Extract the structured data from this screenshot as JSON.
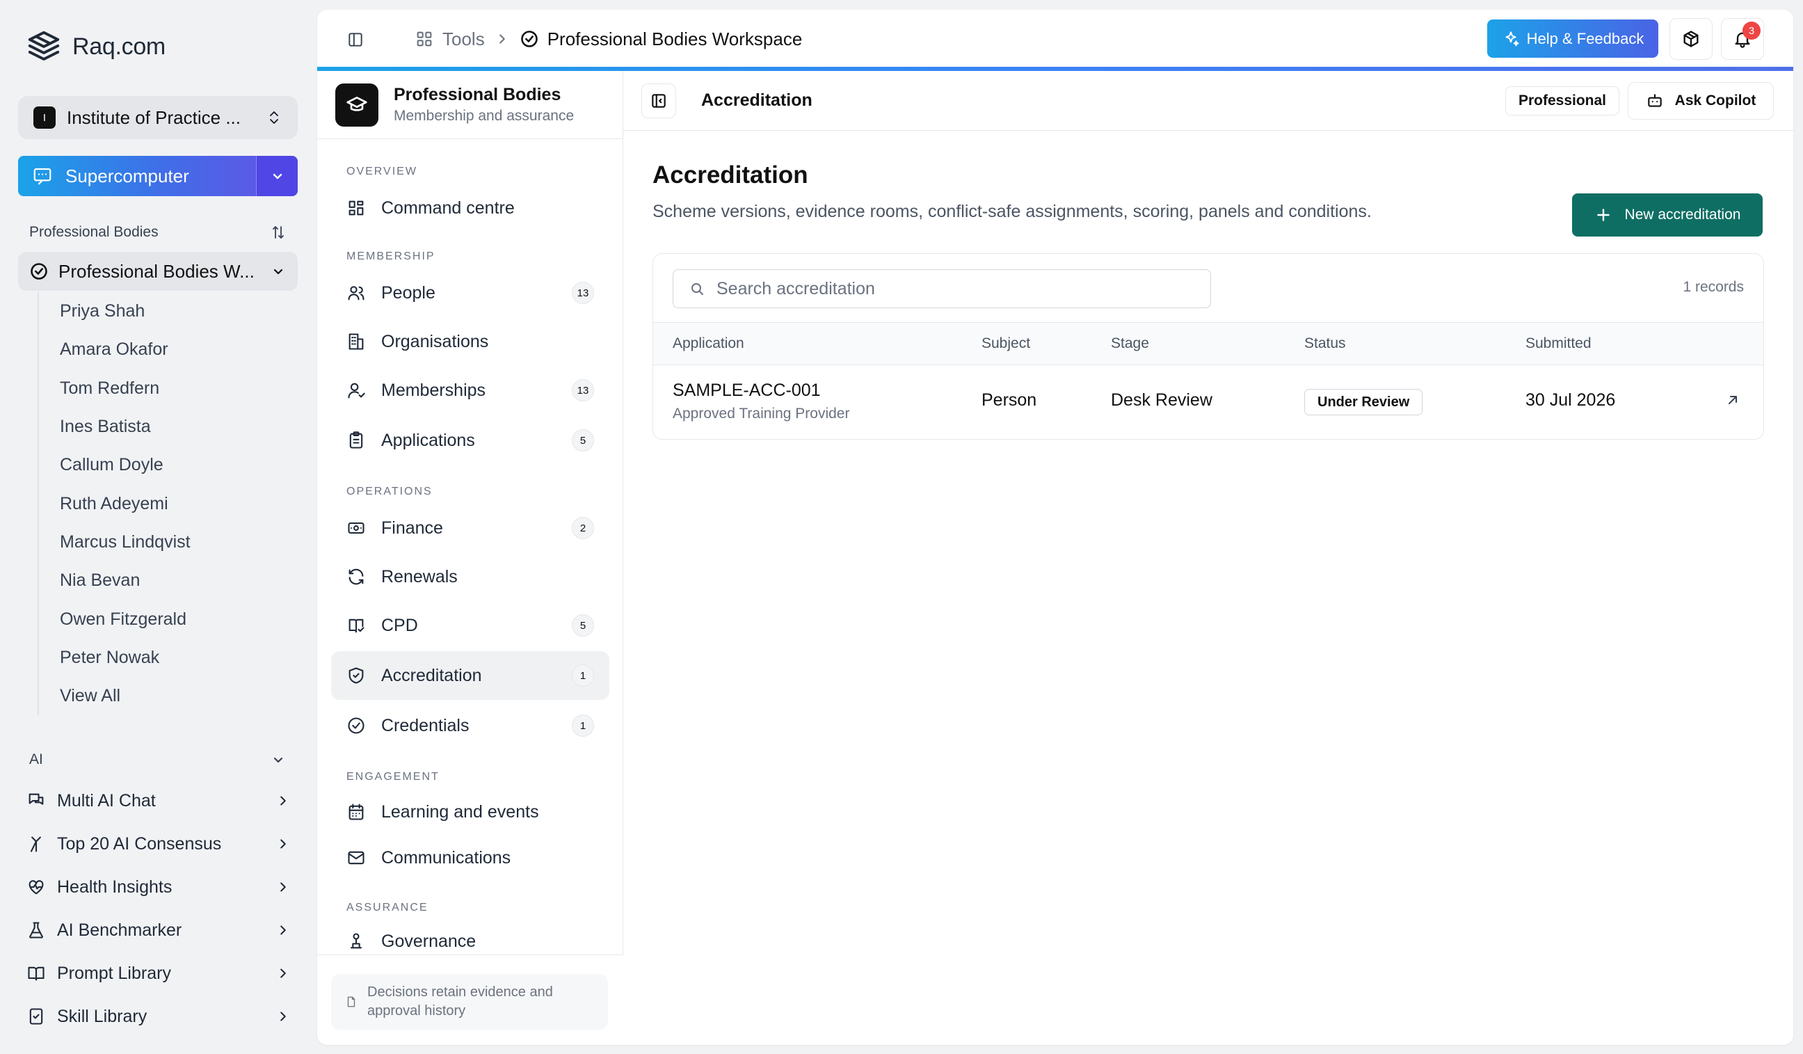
{
  "brand": {
    "name": "Raq.com"
  },
  "org": {
    "initial": "I",
    "name": "Institute of Practice ..."
  },
  "supercomputer": {
    "label": "Supercomputer"
  },
  "sidebar": {
    "section_title": "Professional Bodies",
    "workspace_label": "Professional Bodies W...",
    "members": [
      "Priya Shah",
      "Amara Okafor",
      "Tom Redfern",
      "Ines Batista",
      "Callum Doyle",
      "Ruth Adeyemi",
      "Marcus Lindqvist",
      "Nia Bevan",
      "Owen Fitzgerald",
      "Peter Nowak",
      "View All"
    ],
    "ai_section_title": "AI",
    "ai_items": [
      "Multi AI Chat",
      "Top 20 AI Consensus",
      "Health Insights",
      "AI Benchmarker",
      "Prompt Library",
      "Skill Library"
    ]
  },
  "topbar": {
    "crumb_tools": "Tools",
    "crumb_current": "Professional Bodies Workspace",
    "help_label": "Help & Feedback",
    "notification_count": "3"
  },
  "module": {
    "title": "Professional Bodies",
    "subtitle": "Membership and assurance",
    "groups": {
      "overview": "OVERVIEW",
      "membership": "MEMBERSHIP",
      "operations": "OPERATIONS",
      "engagement": "ENGAGEMENT",
      "assurance": "ASSURANCE"
    },
    "items": {
      "command": {
        "label": "Command centre"
      },
      "people": {
        "label": "People",
        "count": "13"
      },
      "organisations": {
        "label": "Organisations"
      },
      "memberships": {
        "label": "Memberships",
        "count": "13"
      },
      "applications": {
        "label": "Applications",
        "count": "5"
      },
      "finance": {
        "label": "Finance",
        "count": "2"
      },
      "renewals": {
        "label": "Renewals"
      },
      "cpd": {
        "label": "CPD",
        "count": "5"
      },
      "accreditation": {
        "label": "Accreditation",
        "count": "1"
      },
      "credentials": {
        "label": "Credentials",
        "count": "1"
      },
      "learning": {
        "label": "Learning and events"
      },
      "communications": {
        "label": "Communications"
      },
      "governance": {
        "label": "Governance"
      }
    },
    "footer_note": "Decisions retain evidence and approval history"
  },
  "content": {
    "bar_title": "Accreditation",
    "plan_label": "Professional",
    "copilot_label": "Ask Copilot",
    "page_title": "Accreditation",
    "page_desc": "Scheme versions, evidence rooms, conflict-safe assignments, scoring, panels and conditions.",
    "new_button": "New accreditation",
    "search_placeholder": "Search accreditation",
    "records_label": "1 records",
    "columns": {
      "application": "Application",
      "subject": "Subject",
      "stage": "Stage",
      "status": "Status",
      "submitted": "Submitted"
    },
    "rows": [
      {
        "id": "SAMPLE-ACC-001",
        "type": "Approved Training Provider",
        "subject": "Person",
        "stage": "Desk Review",
        "status": "Under Review",
        "submitted": "30 Jul 2026"
      }
    ]
  },
  "colors": {
    "accent_teal": "#0f6e63",
    "accent_blue": "#1ca2e8",
    "badge_red": "#ef4444"
  }
}
